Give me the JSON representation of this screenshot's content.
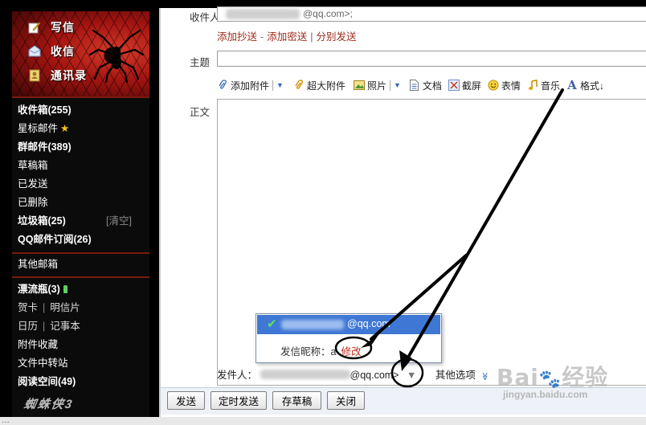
{
  "sidebar": {
    "quick": [
      {
        "label": "写信",
        "icon": "compose-icon"
      },
      {
        "label": "收信",
        "icon": "inbox-icon"
      },
      {
        "label": "通讯录",
        "icon": "contacts-icon"
      }
    ],
    "folders": [
      {
        "label": "收件箱(255)"
      },
      {
        "label": "星标邮件"
      },
      {
        "label": "群邮件(389)"
      },
      {
        "label": "草稿箱"
      },
      {
        "label": "已发送"
      },
      {
        "label": "已删除"
      },
      {
        "label": "垃圾箱(25)",
        "action": "[清空]"
      },
      {
        "label": "QQ邮件订阅(26)"
      }
    ],
    "other_mailbox": "其他邮箱",
    "apps": {
      "drift_bottle": "漂流瓶(3)",
      "greeting_card": "贺卡",
      "postcard": "明信片",
      "calendar": "日历",
      "notebook": "记事本",
      "attachments": "附件收藏",
      "file_transfer": "文件中转站",
      "reading_space": "阅读空间(49)"
    },
    "brand_text": "蜘蛛侠3"
  },
  "compose": {
    "recipient_label": "收件人",
    "recipient_suffix": "@qq.com>;",
    "cc_links": {
      "add_cc": "添加抄送",
      "dash": "-",
      "add_bcc": "添加密送",
      "separator": "|",
      "separate_send": "分别发送"
    },
    "subject_label": "主题",
    "toolbar": {
      "attach": "添加附件",
      "big_attach": "超大附件",
      "photo": "照片",
      "document": "文档",
      "screenshot": "截屏",
      "emoji": "表情",
      "music": "音乐",
      "format": "格式↓"
    },
    "body_label": "正文",
    "sender_dropdown": {
      "email_suffix": "@qq.com",
      "nickname_label": "发信昵称：a",
      "modify": "修改"
    },
    "from": {
      "label": "发件人：",
      "email_suffix": "@qq.com>",
      "arrow": "▼",
      "other_options": "其他选项",
      "other_options_arrow": "≫"
    },
    "buttons": {
      "send": "发送",
      "scheduled": "定时发送",
      "draft": "存草稿",
      "close": "关闭"
    }
  },
  "status_text": "…"
}
